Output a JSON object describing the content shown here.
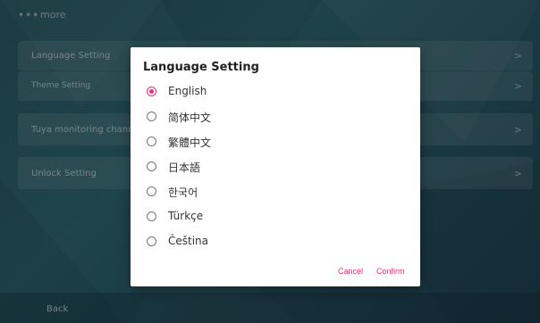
{
  "topbar": {
    "dots": "•••",
    "title": "more"
  },
  "rows": [
    {
      "label": "Language Setting",
      "chevron": ">"
    },
    {
      "label": "Theme Setting",
      "chevron": ">"
    },
    {
      "label": "Tuya monitoring channel",
      "chevron": ">"
    },
    {
      "label": "Unlock Setting",
      "chevron": ">"
    }
  ],
  "bottombar": {
    "back": "Back"
  },
  "dialog": {
    "title": "Language Setting",
    "options": [
      {
        "label": "English",
        "selected": true
      },
      {
        "label": "简体中文",
        "selected": false
      },
      {
        "label": "繁體中文",
        "selected": false
      },
      {
        "label": "日本語",
        "selected": false
      },
      {
        "label": "한국어",
        "selected": false
      },
      {
        "label": "Türkçe",
        "selected": false
      },
      {
        "label": "Čeština",
        "selected": false
      }
    ],
    "cancel": "Cancel",
    "confirm": "Confirm"
  },
  "colors": {
    "accent": "#e8336e",
    "background": "#2b5b66"
  }
}
